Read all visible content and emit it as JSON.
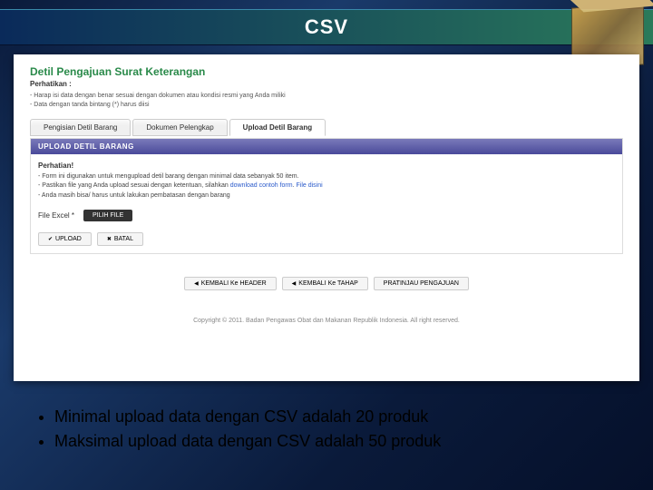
{
  "slide": {
    "title": "CSV",
    "bullets": [
      "Minimal upload data dengan CSV adalah 20 produk",
      "Maksimal upload data dengan CSV adalah 50 produk"
    ]
  },
  "screenshot": {
    "heading": "Detil Pengajuan Surat Keterangan",
    "perhatikan_label": "Perhatikan :",
    "top_notes": [
      "- Harap isi data dengan benar sesuai dengan dokumen atau kondisi resmi yang Anda miliki",
      "- Data dengan tanda bintang (*) harus diisi"
    ],
    "tabs": [
      {
        "label": "Pengisian Detil Barang",
        "active": false
      },
      {
        "label": "Dokumen Pelengkap",
        "active": false
      },
      {
        "label": "Upload Detil Barang",
        "active": true
      }
    ],
    "panel": {
      "header": "UPLOAD DETIL BARANG",
      "sub": "Perhatian!",
      "notes_html": "- Form ini digunakan untuk mengupload detil barang dengan minimal data sebanyak 50 item.<br>- Pastikan file yang Anda upload sesuai dengan ketentuan, silahkan <a>download contoh form</a>. <a>File disini</a><br>- Anda masih bisa/ harus untuk lakukan pembatasan dengan barang",
      "file_label": "File Excel *",
      "browse": "PILIH FILE",
      "upload": "UPLOAD",
      "cancel": "BATAL"
    },
    "nav": {
      "back_header": "KEMBALI Ke HEADER",
      "back_prev": "KEMBALI Ke TAHAP",
      "preview": "PRATINJAU PENGAJUAN"
    },
    "copyright": "Copyright © 2011. Badan Pengawas Obat dan Makanan Republik Indonesia. All right reserved."
  }
}
